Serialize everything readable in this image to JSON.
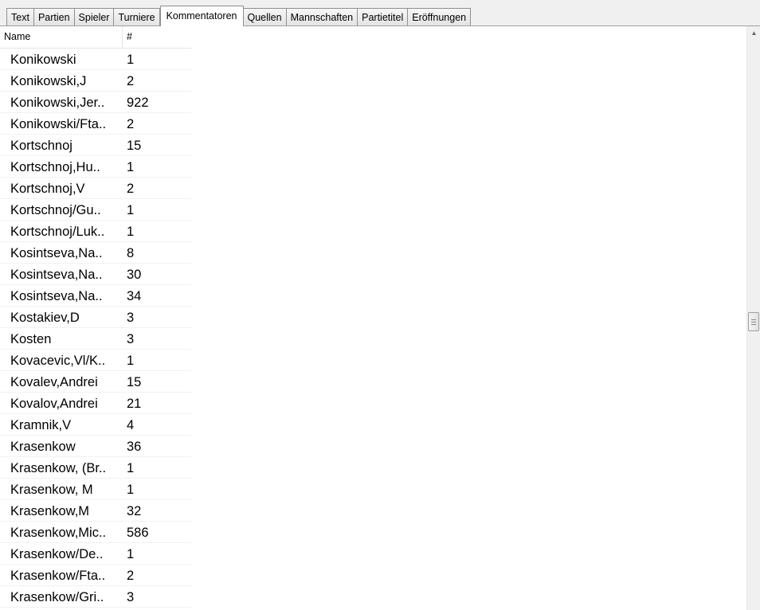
{
  "tabs": [
    {
      "label": "Text",
      "active": false
    },
    {
      "label": "Partien",
      "active": false
    },
    {
      "label": "Spieler",
      "active": false
    },
    {
      "label": "Turniere",
      "active": false
    },
    {
      "label": "Kommentatoren",
      "active": true
    },
    {
      "label": "Quellen",
      "active": false
    },
    {
      "label": "Mannschaften",
      "active": false
    },
    {
      "label": "Partietitel",
      "active": false
    },
    {
      "label": "Eröffnungen",
      "active": false
    }
  ],
  "list": {
    "columns": {
      "name": "Name",
      "count": "#"
    },
    "rows": [
      {
        "name": "Konikowski",
        "count": "1"
      },
      {
        "name": "Konikowski,J",
        "count": "2"
      },
      {
        "name": "Konikowski,Jer..",
        "count": "922"
      },
      {
        "name": "Konikowski/Fta..",
        "count": "2"
      },
      {
        "name": "Kortschnoj",
        "count": "15"
      },
      {
        "name": "Kortschnoj,Hu..",
        "count": "1"
      },
      {
        "name": "Kortschnoj,V",
        "count": "2"
      },
      {
        "name": "Kortschnoj/Gu..",
        "count": "1"
      },
      {
        "name": "Kortschnoj/Luk..",
        "count": "1"
      },
      {
        "name": "Kosintseva,Na..",
        "count": "8"
      },
      {
        "name": "Kosintseva,Na..",
        "count": "30"
      },
      {
        "name": "Kosintseva,Na..",
        "count": "34"
      },
      {
        "name": "Kostakiev,D",
        "count": "3"
      },
      {
        "name": "Kosten",
        "count": "3"
      },
      {
        "name": "Kovacevic,Vl/K..",
        "count": "1"
      },
      {
        "name": "Kovalev,Andrei",
        "count": "15"
      },
      {
        "name": "Kovalov,Andrei",
        "count": "21"
      },
      {
        "name": "Kramnik,V",
        "count": "4"
      },
      {
        "name": "Krasenkow",
        "count": "36"
      },
      {
        "name": "Krasenkow, (Br..",
        "count": "1"
      },
      {
        "name": "Krasenkow, M",
        "count": "1"
      },
      {
        "name": "Krasenkow,M",
        "count": "32"
      },
      {
        "name": "Krasenkow,Mic..",
        "count": "586"
      },
      {
        "name": "Krasenkow/De..",
        "count": "1"
      },
      {
        "name": "Krasenkow/Fta..",
        "count": "2"
      },
      {
        "name": "Krasenkow/Gri..",
        "count": "3"
      }
    ]
  },
  "scrollbar": {
    "up_arrow_icon": "triangle-up-icon",
    "thumb_grip_icon": "grip-lines-icon",
    "position": 0.5
  }
}
